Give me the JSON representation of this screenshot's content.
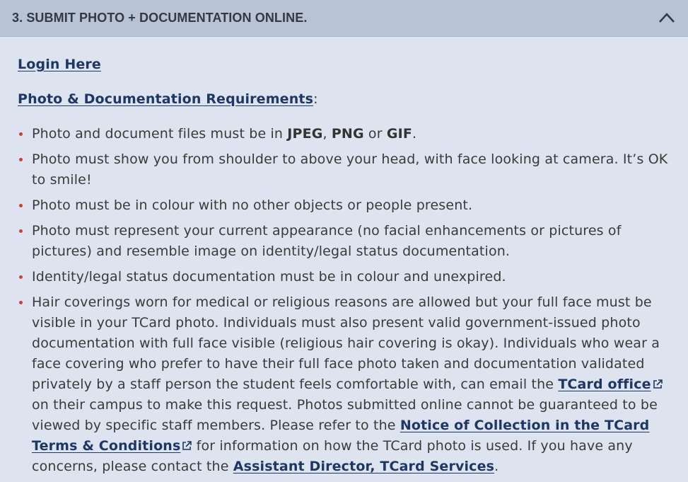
{
  "section": {
    "title": "3. SUBMIT PHOTO + DOCUMENTATION ONLINE.",
    "toggle_icon": "chevron-up-icon"
  },
  "links": {
    "login": "Login Here",
    "requirements": "Photo & Documentation Requirements",
    "requirements_suffix": ":"
  },
  "items": {
    "i1": {
      "a": "Photo and document files must be in ",
      "jpeg": "JPEG",
      "comma": ", ",
      "png": "PNG",
      "or": " or ",
      "gif": "GIF",
      "end": "."
    },
    "i2": "Photo must show you from shoulder to above your head, with face looking at camera. It’s OK to smile!",
    "i3": "Photo must be in colour with no other objects or people present.",
    "i4": "Photo must represent your current appearance (no facial enhancements or pictures of pictures) and resemble image on identity/legal status documentation.",
    "i5": "Identity/legal status documentation must be in colour and unexpired.",
    "i6": {
      "a": "Hair coverings worn for medical or religious reasons are allowed but your full face must be visible in your TCard photo. Individuals must also present valid government-issued photo documentation with full face visible (religious hair covering is okay). Individuals who wear a face covering who prefer to have their full face photo taken and documentation validated privately by a staff person the student feels comfortable with, can email the ",
      "tcard_link": "TCard office",
      "b": " on their campus to make this request. Photos submitted online cannot be guaranteed to be viewed by specific staff members. Please refer to the ",
      "notice_link": "Notice of Collection in the TCard Terms & Conditions",
      "c": " for information on how the TCard photo is used.  If you have any concerns, please contact the ",
      "director_link": "Assistant Director, TCard Services",
      "d": "."
    }
  },
  "colors": {
    "bullet": "#c8413a",
    "link": "#1e3765",
    "header_bg": "#b9c3d6",
    "body_bg": "#dde3ef"
  }
}
